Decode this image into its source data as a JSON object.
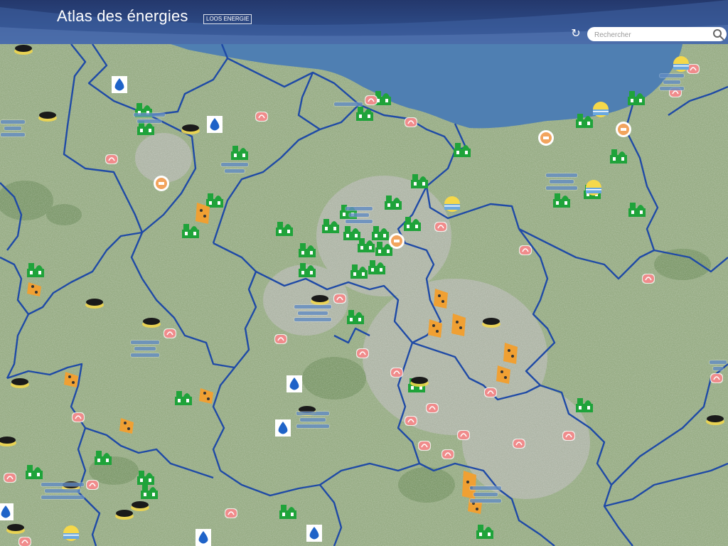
{
  "header": {
    "title": "Atlas des énergies",
    "subtitle": "LOOS ENERGIE",
    "refresh_icon": "refresh-icon",
    "search": {
      "placeholder": "Rechercher",
      "icon": "search-icon"
    }
  },
  "colors": {
    "header_bg": "#2d4a86",
    "sea": "#4d7db0",
    "boundary": "#1f4aa6",
    "biogas": "#1fa33a",
    "wind": "#f0a033",
    "incinerator": "#f08c8c",
    "hydro": "#1f63c8",
    "solar": "#f5d84a",
    "geothermal": "#1a1a1a",
    "label": "#1e5aa8"
  },
  "map": {
    "layer": "Atlas des énergies",
    "legend_icons": [
      "biogas-plant-icon",
      "wind-farm-icon",
      "incinerator-icon",
      "hydro-plant-icon",
      "solar-plant-icon",
      "geothermal-icon",
      "heat-network-icon"
    ]
  }
}
